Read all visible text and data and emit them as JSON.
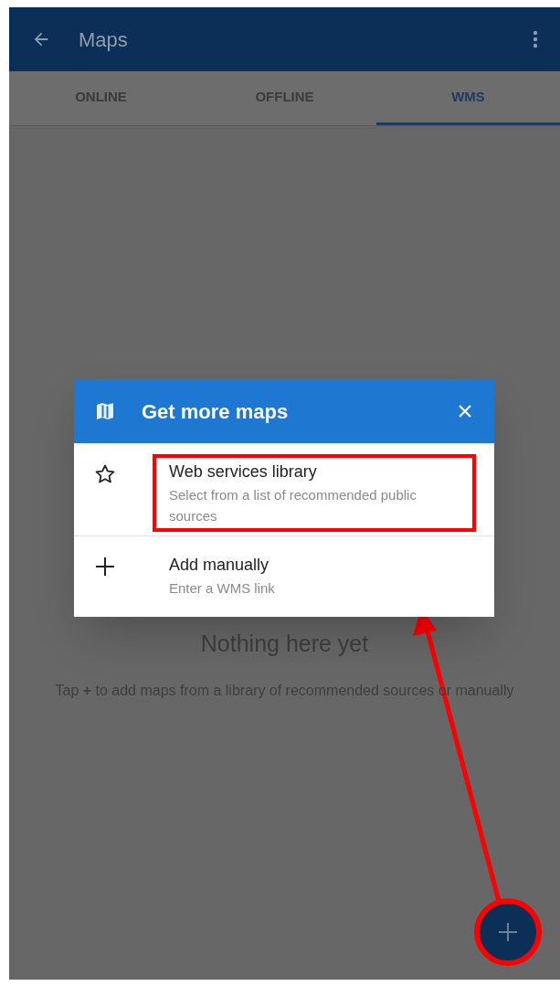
{
  "app_bar": {
    "title": "Maps"
  },
  "tabs": [
    {
      "label": "ONLINE",
      "selected": false
    },
    {
      "label": "OFFLINE",
      "selected": false
    },
    {
      "label": "WMS",
      "selected": true
    }
  ],
  "empty_state": {
    "title": "Nothing here yet",
    "message": "Tap **+** to add maps from a library of recommended sources or manually"
  },
  "dialog": {
    "title": "Get more maps",
    "items": [
      {
        "kind": "star",
        "title": "Web services library",
        "subtitle": "Select from a list of recommended public sources",
        "highlighted": true
      },
      {
        "kind": "plus",
        "title": "Add manually",
        "subtitle": "Enter a WMS link",
        "highlighted": false
      }
    ]
  }
}
